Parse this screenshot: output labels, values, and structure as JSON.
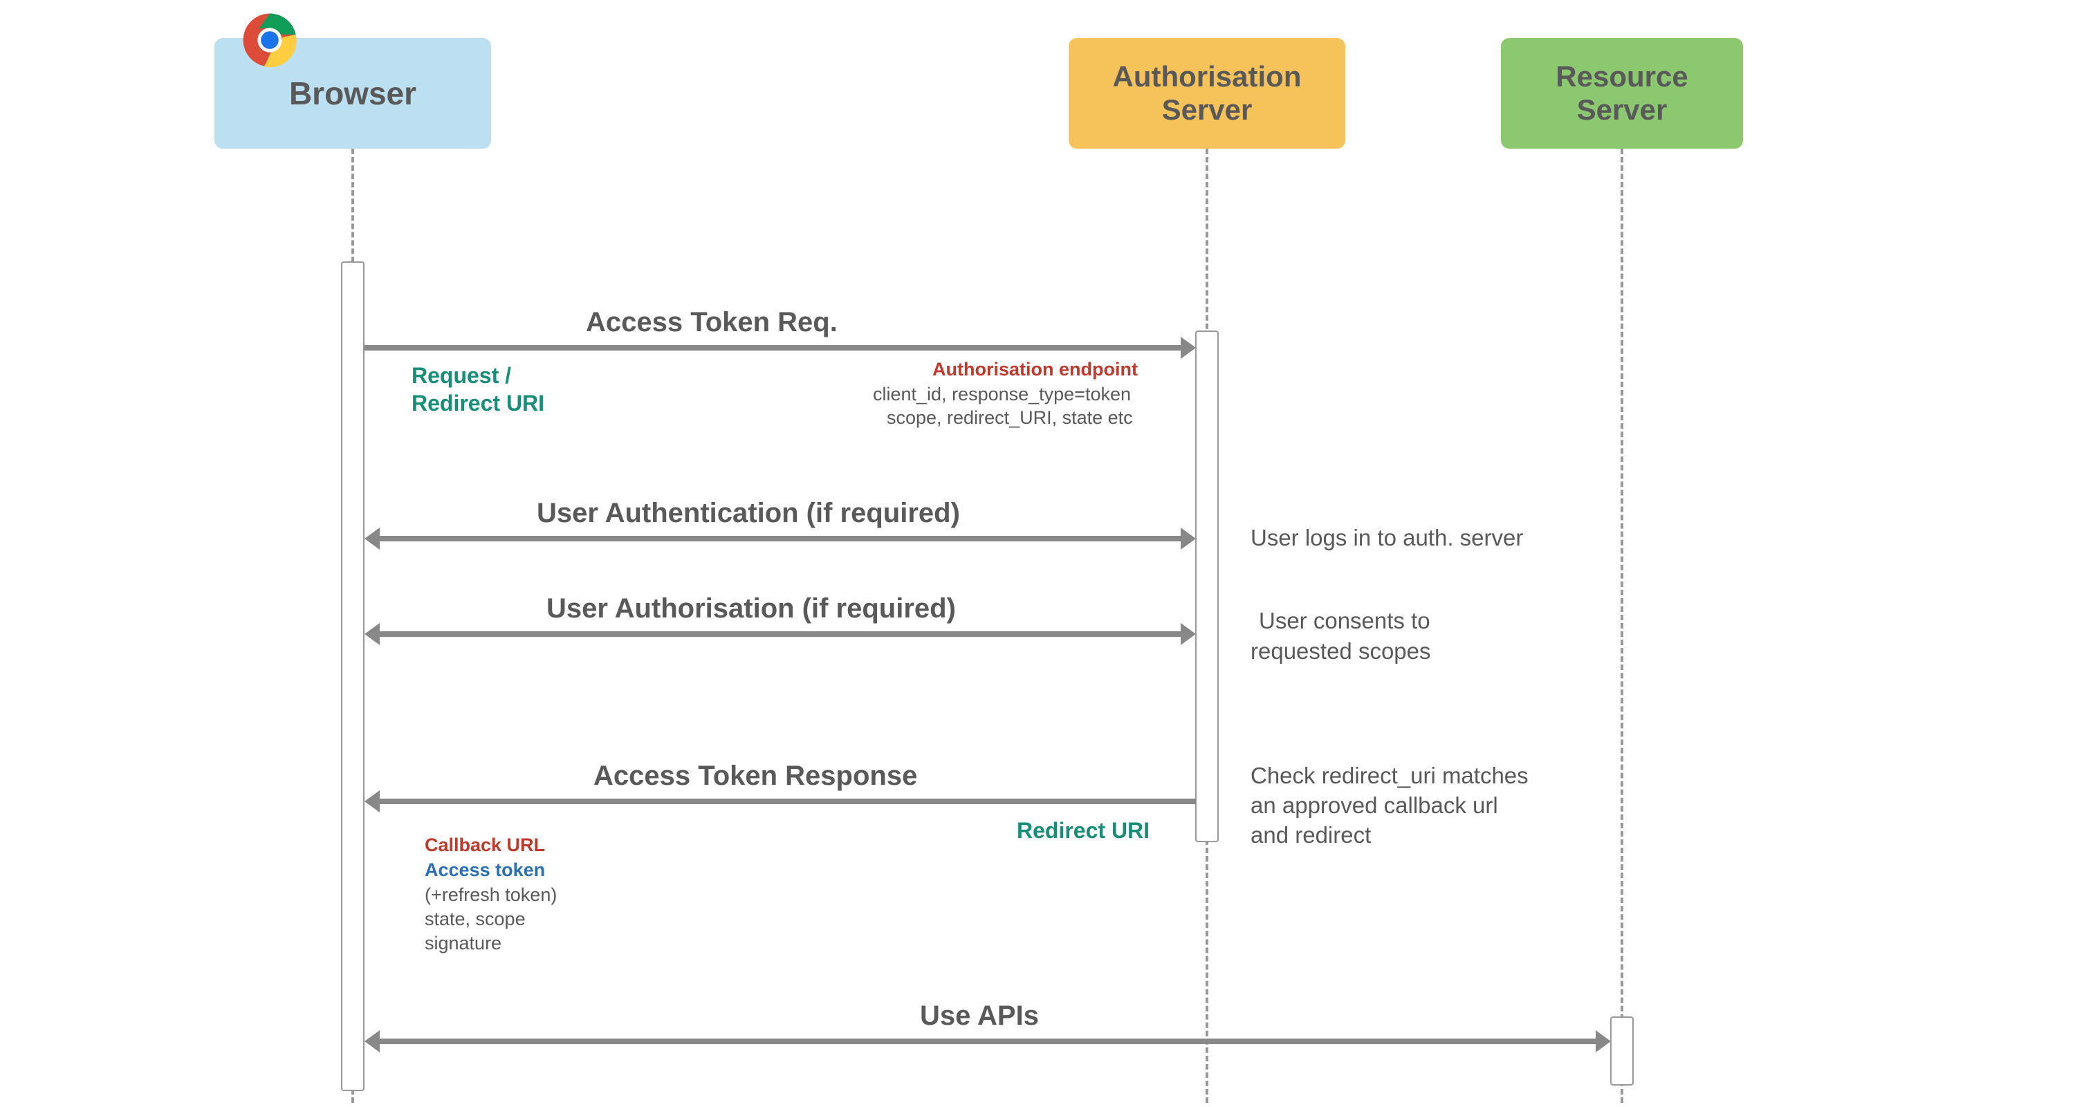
{
  "participants": {
    "browser": {
      "label": "Browser",
      "color": "#bcdff1"
    },
    "auth": {
      "label": "Authorisation\nServer",
      "color": "#f6c35b"
    },
    "resource": {
      "label": "Resource\nServer",
      "color": "#8bc870"
    }
  },
  "messages": {
    "m1": {
      "label": "Access Token Req.",
      "left_note_1": "Request /",
      "left_note_2": "Redirect URI",
      "right_note_title": "Authorisation endpoint",
      "right_note_body_1": "client_id, response_type=token",
      "right_note_body_2": "scope, redirect_URI, state etc"
    },
    "m2": {
      "label": "User Authentication (if required)",
      "side_note": "User logs in to auth. server"
    },
    "m3": {
      "label": "User Authorisation (if required)",
      "side_note_1": "User consents to",
      "side_note_2": "requested scopes"
    },
    "m4": {
      "label": "Access Token Response",
      "side_note_1": "Check redirect_uri matches",
      "side_note_2": "an approved callback url",
      "side_note_3": "and redirect",
      "right_label": "Redirect URI",
      "resp_1": "Callback URL",
      "resp_2": "Access token",
      "resp_3": "(+refresh token)",
      "resp_4": "state, scope",
      "resp_5": "signature"
    },
    "m5": {
      "label": "Use APIs"
    }
  }
}
